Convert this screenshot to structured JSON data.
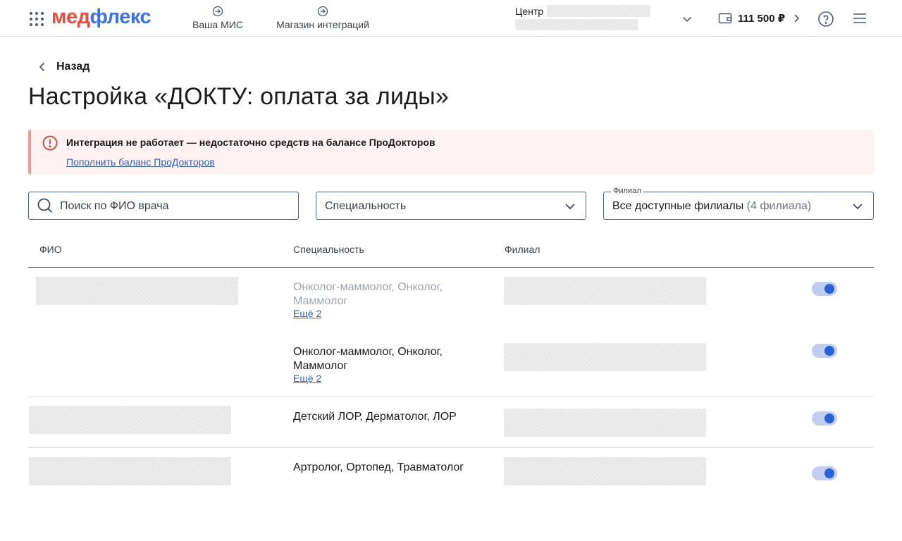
{
  "header": {
    "logo_part1": "мед",
    "logo_part2": "флекс",
    "nav": [
      {
        "label": "Ваша МИС",
        "icon": "login-icon"
      },
      {
        "label": "Магазин интеграций",
        "icon": "login-icon"
      }
    ],
    "center_label": "Центр",
    "balance": "111 500 ₽",
    "icons": [
      "apps-grid-icon",
      "chevron-down-icon",
      "wallet-icon",
      "chevron-right-icon",
      "help-icon",
      "menu-icon"
    ]
  },
  "page": {
    "back_label": "Назад",
    "title": "Настройка «ДОКТУ: оплата за лиды»"
  },
  "alert": {
    "title": "Интеграция не работает — недостаточно средств на балансе ПроДокторов",
    "link": "Пополнить баланс ПроДокторов",
    "color": "#fff2f0"
  },
  "filters": {
    "search_placeholder": "Поиск по ФИО врача",
    "specialty_placeholder": "Специальность",
    "branch_label": "Филиал",
    "branch_value": "Все доступные филиалы",
    "branch_count": "(4 филиала)"
  },
  "table": {
    "headers": [
      "ФИО",
      "Специальность",
      "Филиал"
    ],
    "rows": [
      {
        "specialty": "Онколог-маммолог, Онколог, Маммолог",
        "more": "Ещё 2",
        "enabled": true,
        "disabled_text": true
      },
      {
        "specialty": "Онколог-маммолог, Онколог, Маммолог",
        "more": "Ещё 2",
        "enabled": true,
        "disabled_text": false
      },
      {
        "specialty": "Детский ЛОР, Дерматолог, ЛОР",
        "more": "",
        "enabled": true,
        "disabled_text": false
      },
      {
        "specialty": "Артролог, Ортопед, Травматолог",
        "more": "",
        "enabled": true,
        "disabled_text": false
      }
    ]
  },
  "colors": {
    "accent": "#2563d6",
    "brand_red": "#ef4b3f",
    "brand_blue": "#3d73e8",
    "link": "#2f5fc2"
  }
}
